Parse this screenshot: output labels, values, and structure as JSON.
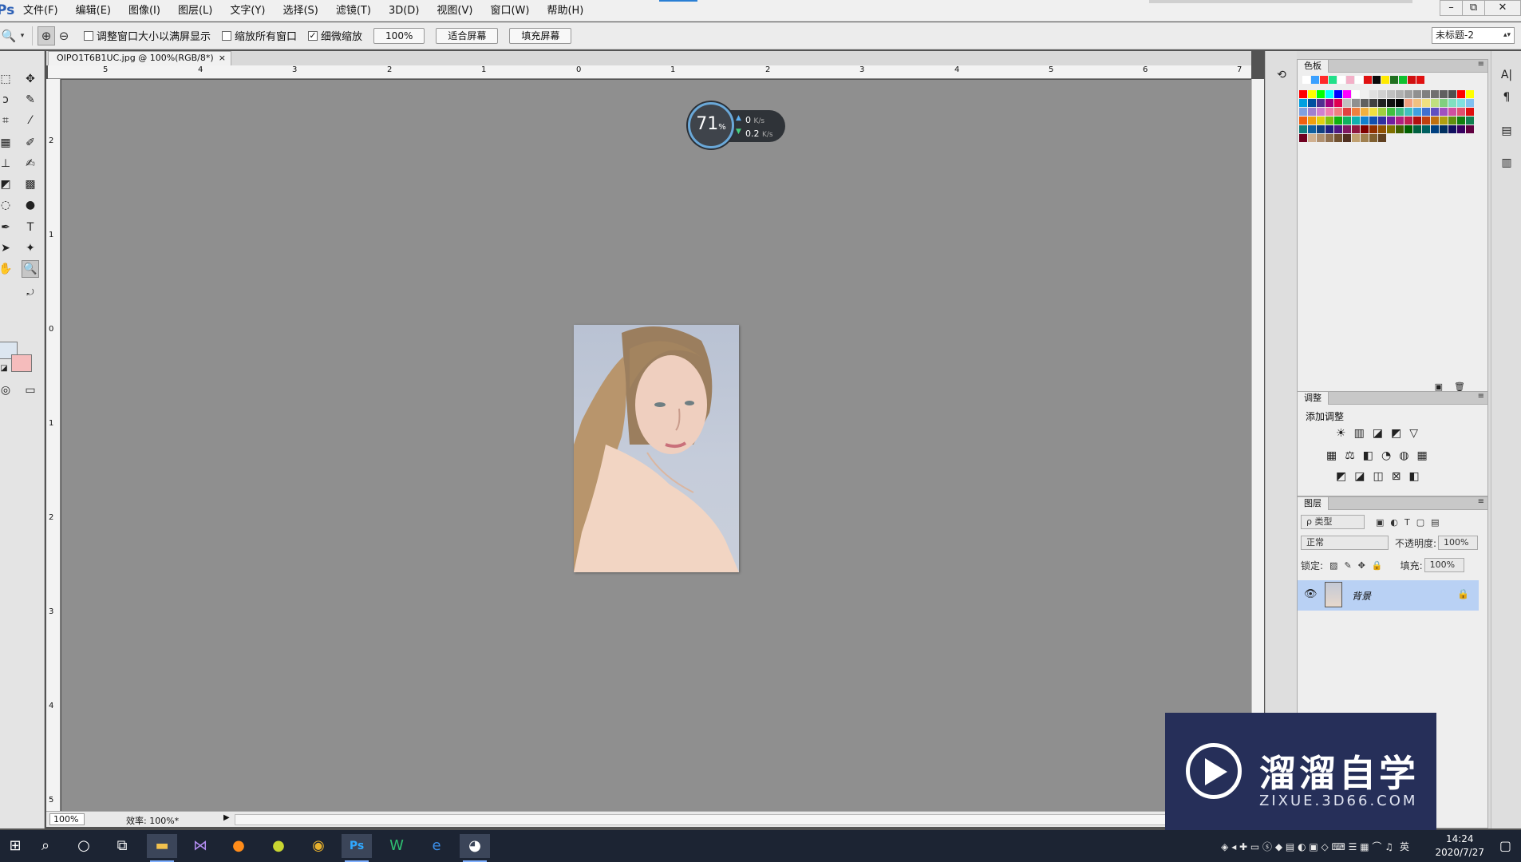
{
  "menubar": {
    "logo": "Ps",
    "items": [
      "文件(F)",
      "编辑(E)",
      "图像(I)",
      "图层(L)",
      "文字(Y)",
      "选择(S)",
      "滤镜(T)",
      "3D(D)",
      "视图(V)",
      "窗口(W)",
      "帮助(H)"
    ],
    "window_controls": [
      "–",
      "⧉",
      "✕"
    ]
  },
  "options": {
    "resize_windows_label": "调整窗口大小以满屏显示",
    "zoom_all_windows_label": "缩放所有窗口",
    "scrubby_zoom_label": "细微缩放",
    "scrubby_zoom_checked": true,
    "zoom_value": "100%",
    "fit_screen_label": "适合屏幕",
    "fill_screen_label": "填充屏幕",
    "document_select": "未标题-2"
  },
  "document": {
    "tab_title": "OIPO1T6B1UC.jpg @ 100%(RGB/8*)",
    "tab_close": "×",
    "zoom_status": "100%",
    "efficiency": "效率: 100%*",
    "ruler_h": [
      "5",
      "4",
      "3",
      "2",
      "1",
      "0",
      "1",
      "2",
      "3",
      "4",
      "5",
      "6",
      "7"
    ],
    "ruler_v": [
      "2",
      "1",
      "0",
      "1",
      "2",
      "3",
      "4",
      "5"
    ]
  },
  "network_widget": {
    "percent": "71",
    "percent_unit": "%",
    "upload": "0",
    "upload_unit": "K/s",
    "download": "0.2",
    "download_unit": "K/s"
  },
  "panels": {
    "swatches": {
      "title": "色板",
      "recent": [
        "#ffffff",
        "#3aa0ff",
        "#ff2a2a",
        "#22e08a",
        "#ffffff",
        "#f3b0c8",
        "#ffffff",
        "#e01010",
        "#0a0a0a",
        "#ffea00",
        "#207020",
        "#10c030",
        "#d01010",
        "#e01010"
      ],
      "colors": [
        "#ff0000",
        "#ffff00",
        "#00ff00",
        "#00ffff",
        "#0000ff",
        "#ff00ff",
        "#ffffff",
        "#f0f0f0",
        "#e0e0e0",
        "#d0d0d0",
        "#c0c0c0",
        "#b0b0b0",
        "#a0a0a0",
        "#909090",
        "#808080",
        "#707070",
        "#606060",
        "#505050",
        "#ff0000",
        "#ffff00",
        "#00a0e0",
        "#0050a0",
        "#503090",
        "#a00080",
        "#e00050",
        "#c0c0c0",
        "#909090",
        "#606060",
        "#404040",
        "#202020",
        "#101010",
        "#000000",
        "#f0a080",
        "#f0c080",
        "#f0e080",
        "#c0e080",
        "#80d080",
        "#80e0c0",
        "#80e0e0",
        "#80c0f0",
        "#80a0e0",
        "#a080d0",
        "#d080d0",
        "#f080b0",
        "#f08080",
        "#e04040",
        "#f08040",
        "#f0b040",
        "#f0e040",
        "#a0d040",
        "#40c040",
        "#40c080",
        "#40c0c0",
        "#40a0e0",
        "#4070d0",
        "#6050c0",
        "#a050c0",
        "#d050a0",
        "#e05070",
        "#e01010",
        "#f06010",
        "#f0a010",
        "#e0d010",
        "#80c010",
        "#10b010",
        "#10b060",
        "#10b0b0",
        "#1080d0",
        "#1050b0",
        "#3030a0",
        "#7020a0",
        "#b02080",
        "#c02050",
        "#b01010",
        "#c04010",
        "#c07010",
        "#b0a010",
        "#609010",
        "#108010",
        "#108050",
        "#108080",
        "#1060a0",
        "#104080",
        "#202080",
        "#501880",
        "#801860",
        "#901840",
        "#800000",
        "#903000",
        "#905000",
        "#807000",
        "#406000",
        "#006000",
        "#006040",
        "#006060",
        "#004080",
        "#003060",
        "#101060",
        "#380060",
        "#600040",
        "#700020",
        "#d0b090",
        "#b09070",
        "#907050",
        "#705030",
        "#503020",
        "#c0a070",
        "#a08050",
        "#806030",
        "#604020"
      ]
    },
    "adjustments": {
      "title": "调整",
      "add_label": "添加调整",
      "row1": [
        "☀",
        "▥",
        "◪",
        "◩",
        "▽"
      ],
      "row2": [
        "▦",
        "⚖",
        "◧",
        "◔",
        "◍",
        "▦"
      ],
      "row3": [
        "◩",
        "◪",
        "◫",
        "⊠",
        "◧"
      ]
    },
    "layers": {
      "title": "图层",
      "filter_label": "ρ 类型",
      "blend_mode": "正常",
      "opacity_label": "不透明度:",
      "opacity_value": "100%",
      "lock_label": "锁定:",
      "fill_label": "填充:",
      "fill_value": "100%",
      "layer_name": "背景"
    }
  },
  "watermark": {
    "cn": "溜溜自学",
    "en": "ZIXUE.3D66.COM"
  },
  "taskbar": {
    "time": "14:24",
    "date": "2020/7/27",
    "ime": "英"
  }
}
